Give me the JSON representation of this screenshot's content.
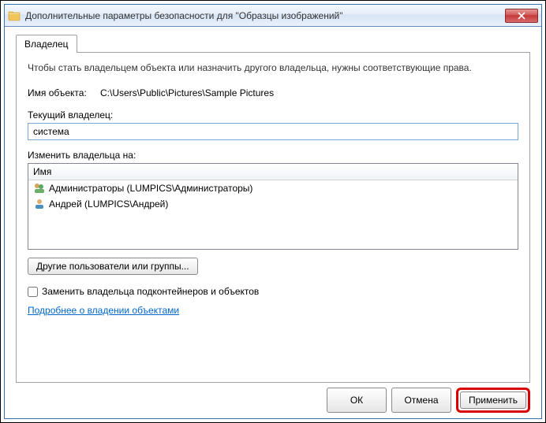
{
  "window": {
    "title": "Дополнительные параметры безопасности для \"Образцы изображений\""
  },
  "tabs": {
    "owner": "Владелец"
  },
  "content": {
    "description": "Чтобы стать владельцем объекта или назначить другого владельца, нужны соответствующие права.",
    "object_name_label": "Имя объекта:",
    "object_name_value": "C:\\Users\\Public\\Pictures\\Sample Pictures",
    "current_owner_label": "Текущий владелец:",
    "current_owner_value": "система",
    "change_owner_label": "Изменить владельца на:",
    "list_header": "Имя",
    "list_items": [
      "Администраторы (LUMPICS\\Администраторы)",
      "Андрей (LUMPICS\\Андрей)"
    ],
    "other_users_button": "Другие пользователи или группы...",
    "replace_owner_checkbox": "Заменить владельца подконтейнеров и объектов",
    "more_info_link": "Подробнее о владении объектами"
  },
  "buttons": {
    "ok": "ОК",
    "cancel": "Отмена",
    "apply": "Применить"
  }
}
